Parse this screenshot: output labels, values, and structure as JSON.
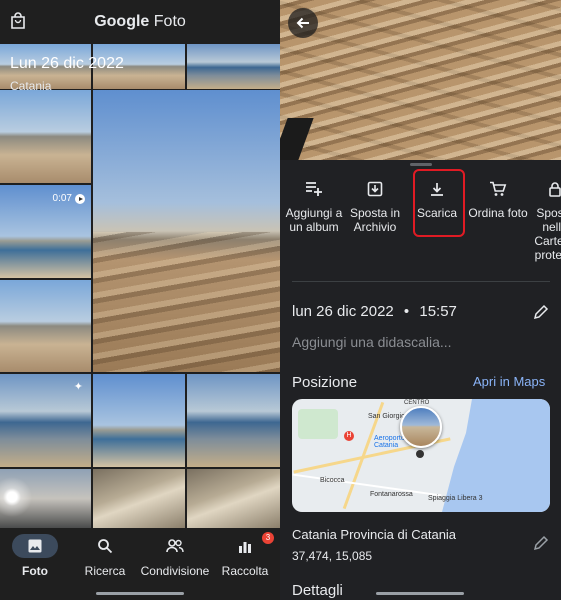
{
  "left": {
    "brand": {
      "google": "Google",
      "product": "Foto"
    },
    "date_header": "Lun 26 dic 2022",
    "location": "Catania",
    "video_duration": "0:07",
    "nav": [
      {
        "label": "Foto",
        "icon": "photo-icon",
        "active": true
      },
      {
        "label": "Ricerca",
        "icon": "search-icon",
        "active": false
      },
      {
        "label": "Condivisione",
        "icon": "people-icon",
        "active": false
      },
      {
        "label": "Raccolta",
        "icon": "library-icon",
        "active": false,
        "badge": "3"
      }
    ]
  },
  "right": {
    "actions": [
      {
        "label": "Aggiungi a un album",
        "icon": "add-to-playlist-icon"
      },
      {
        "label": "Sposta in Archivio",
        "icon": "archive-icon"
      },
      {
        "label": "Scarica",
        "icon": "download-icon",
        "highlighted": true
      },
      {
        "label": "Ordina foto",
        "icon": "cart-icon"
      },
      {
        "label": "Sposta nella Cartella protetta",
        "icon": "lock-icon"
      }
    ],
    "date": "lun 26 dic 2022",
    "separator": "•",
    "time": "15:57",
    "caption_placeholder": "Aggiungi una didascalia...",
    "position_title": "Posizione",
    "maps_link": "Apri in Maps",
    "map_labels": {
      "san_giorgio": "San Giorgio",
      "aeroporto": "Aeroporto di Catania",
      "bicocca": "Bicocca",
      "fontanarossa": "Fontanarossa",
      "spiaggia": "Spiaggia Libera 3",
      "centro": "CENTRO"
    },
    "place_name": "Catania Provincia di Catania",
    "coordinates": "37,474, 15,085",
    "details_title": "Dettagli"
  },
  "colors": {
    "accent_blue": "#8ab4f8",
    "highlight_red": "#e01b24",
    "background_dark": "#202124"
  }
}
